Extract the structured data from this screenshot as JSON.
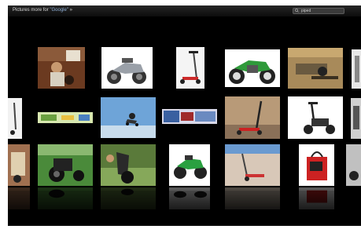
{
  "header": {
    "title_prefix": "Pictures",
    "title_middle": " more for ",
    "title_query": "\"Google\"",
    "title_suffix": " »"
  },
  "search": {
    "value": "piped",
    "icon": "search-icon"
  },
  "colors": {
    "background": "#000000",
    "topbar": "#1a1a1a",
    "accent": "#8fb0d8"
  },
  "results": {
    "rows": [
      {
        "items": [
          "scooter-rider-photo",
          "pocket-bike-silver",
          "kick-scooter-red",
          "dirt-bike-green",
          "scooter-closeup",
          "partial-scooter"
        ]
      },
      {
        "items": [
          "partial-scooter-left",
          "banner-ad",
          "stunt-rider-sky",
          "banner-strip",
          "red-scooter-indoor",
          "electric-scooter-black",
          "partial-right"
        ]
      },
      {
        "items": [
          "partial-left-bottom",
          "black-scooter-grass",
          "bike-on-grass",
          "green-pocket-bike",
          "scooter-on-table",
          "red-shopping-bag",
          "partial-right-bottom"
        ]
      }
    ]
  }
}
